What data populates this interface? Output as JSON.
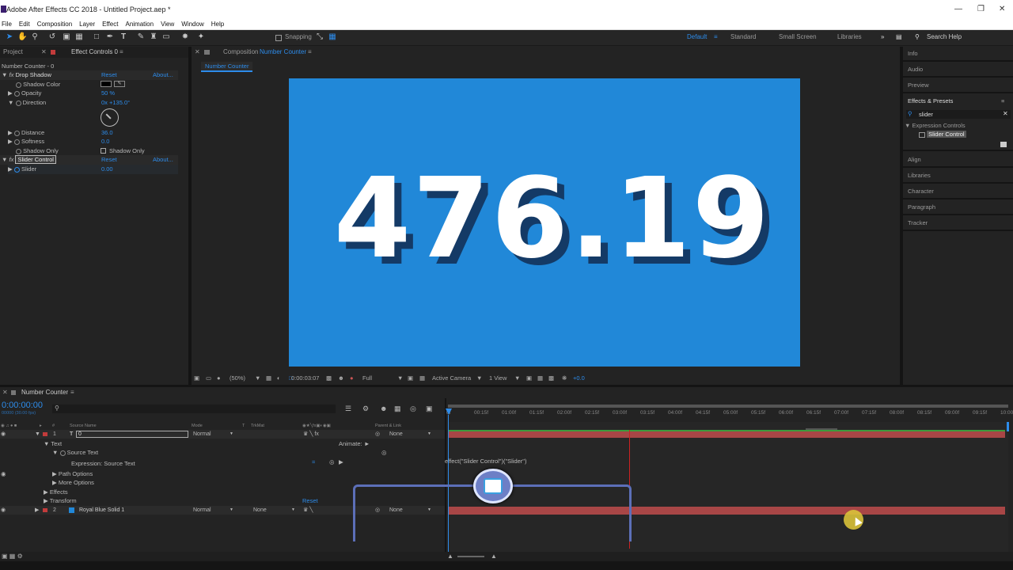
{
  "app": {
    "title": "Adobe After Effects CC 2018 - Untitled Project.aep *"
  },
  "menu": [
    "File",
    "Edit",
    "Composition",
    "Layer",
    "Effect",
    "Animation",
    "View",
    "Window",
    "Help"
  ],
  "toolbar": {
    "snapping": "Snapping",
    "workspaces": [
      "Default",
      "Standard",
      "Small Screen",
      "Libraries"
    ],
    "search_placeholder": "Search Help"
  },
  "left_panel": {
    "tabs": [
      "Project",
      "Effect Controls 0"
    ],
    "subtitle": "Number Counter - 0",
    "effects": [
      {
        "name": "Drop Shadow",
        "reset": "Reset",
        "about": "About...",
        "props": [
          {
            "name": "Shadow Color",
            "value": ""
          },
          {
            "name": "Opacity",
            "value": "50 %"
          },
          {
            "name": "Direction",
            "value": "0x +135.0°"
          },
          {
            "name": "Distance",
            "value": "36.0"
          },
          {
            "name": "Softness",
            "value": "0.0"
          },
          {
            "name": "Shadow Only",
            "value": "Shadow Only"
          }
        ]
      },
      {
        "name": "Slider Control",
        "reset": "Reset",
        "about": "About...",
        "props": [
          {
            "name": "Slider",
            "value": "0.00"
          }
        ]
      }
    ]
  },
  "composition": {
    "tab_prefix": "Composition",
    "tab_name": "Number Counter",
    "chip": "Number Counter",
    "display": "476.19",
    "bg": "#2188d8",
    "footer": {
      "zoom": "(50%)",
      "time": "0:00:03:07",
      "res": "Full",
      "camera": "Active Camera",
      "view": "1 View",
      "exposure": "+0.0"
    }
  },
  "right_panel": {
    "items_top": [
      "Info",
      "Audio",
      "Preview"
    ],
    "effects_presets": {
      "title": "Effects & Presets",
      "search": "slider",
      "group": "Expression Controls",
      "item": "Slider Control"
    },
    "items_bottom": [
      "Align",
      "Libraries",
      "Character",
      "Paragraph",
      "Tracker"
    ]
  },
  "timeline": {
    "tab": "Number Counter",
    "timecode": "0:00:00:00",
    "fps": "00000 (30.00 fps)",
    "columns": [
      "#",
      "Source Name",
      "Mode",
      "T",
      "TrkMat",
      "Parent & Link"
    ],
    "layers": [
      {
        "num": "1",
        "name": "0",
        "mode": "Normal",
        "trkmat": "",
        "parent": "None"
      },
      {
        "num": "2",
        "name": "Royal Blue Solid 1",
        "mode": "Normal",
        "trkmat": "None",
        "parent": "None"
      }
    ],
    "sub": {
      "text": "Text",
      "animate": "Animate:",
      "source_text": "Source Text",
      "expression": "Expression: Source Text",
      "path_options": "Path Options",
      "more_options": "More Options",
      "effects": "Effects",
      "transform": "Transform",
      "reset": "Reset"
    },
    "expression_code": "effect(\"Slider Control\")(\"Slider\")",
    "ruler": [
      "0f",
      "00:15f",
      "01:00f",
      "01:15f",
      "02:00f",
      "02:15f",
      "03:00f",
      "03:15f",
      "04:00f",
      "04:15f",
      "05:00f",
      "05:15f",
      "06:00f",
      "06:15f",
      "07:00f",
      "07:15f",
      "08:00f",
      "08:15f",
      "09:00f",
      "09:15f",
      "10:00"
    ]
  },
  "colors": {
    "accent": "#2d8ceb",
    "layer_red": "#a84646",
    "comp_blue": "#2188d8"
  }
}
